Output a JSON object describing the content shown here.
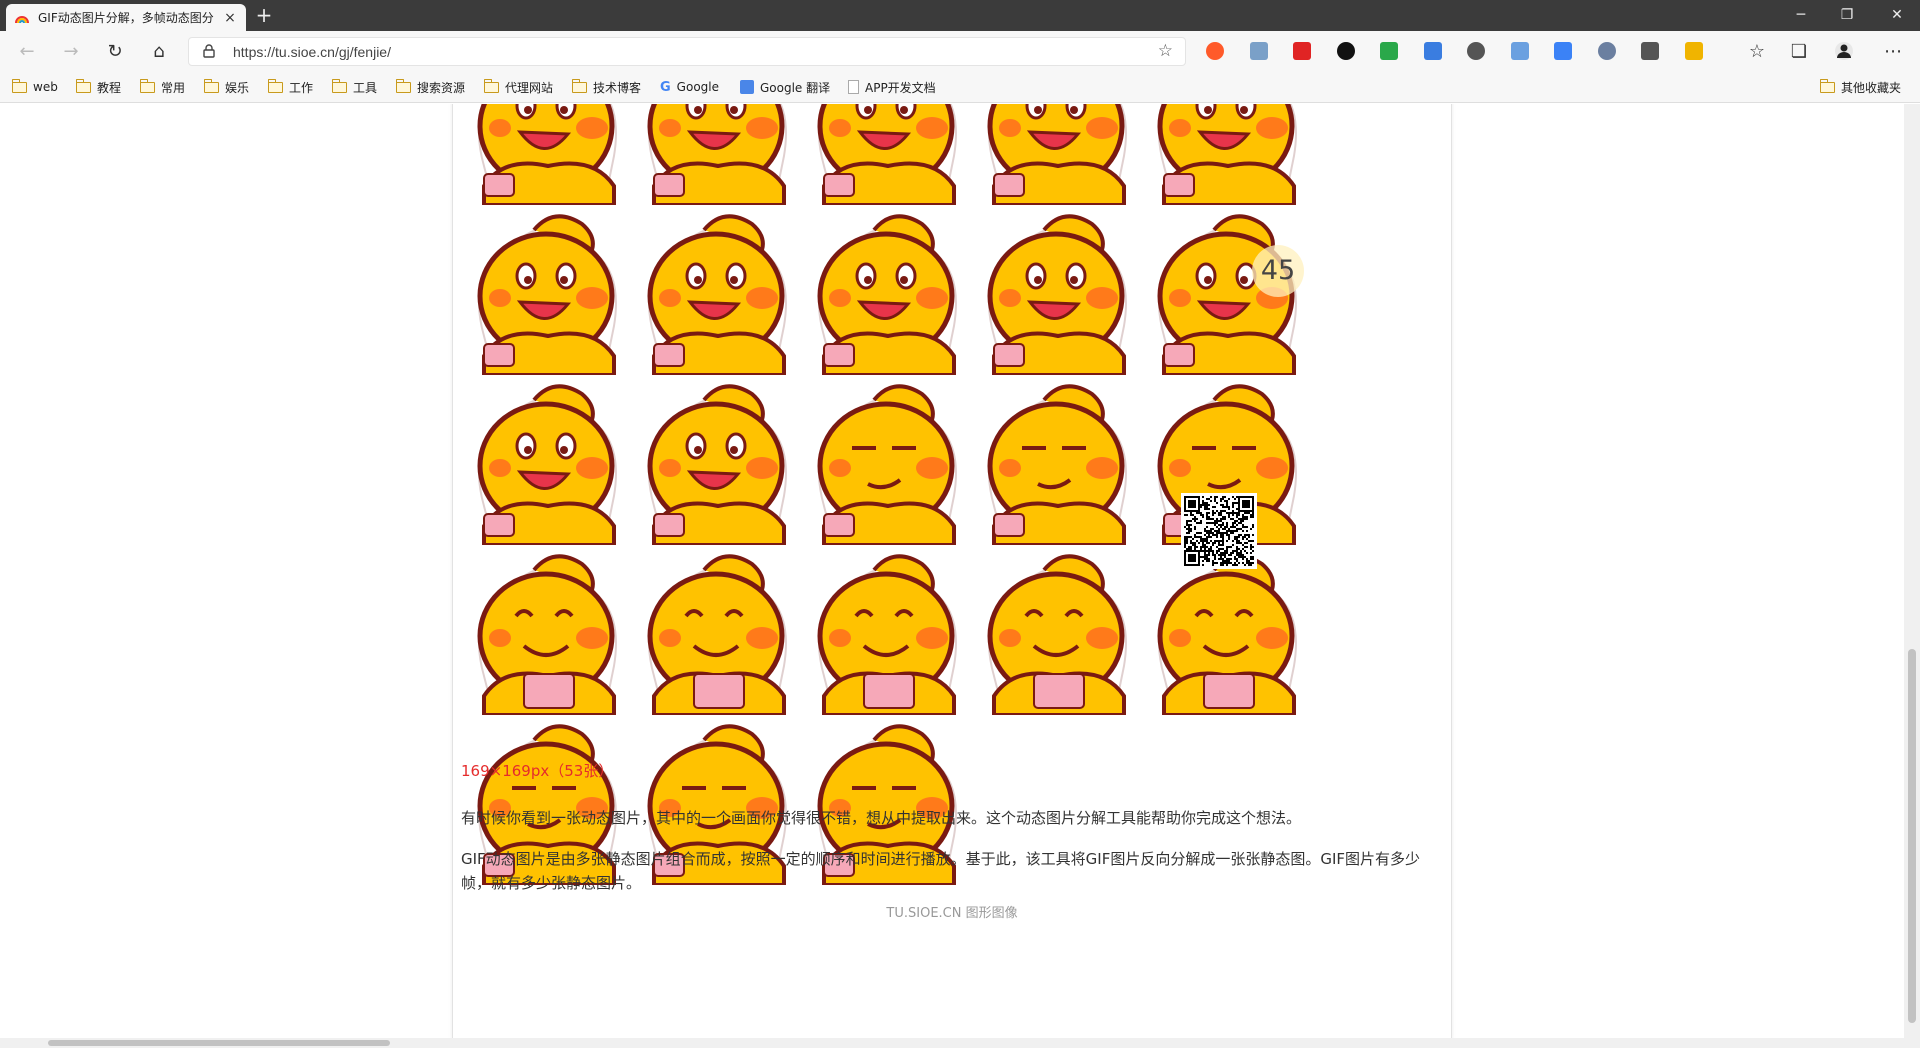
{
  "browser": {
    "tab": {
      "title": "GIF动态图片分解，多帧动态图分",
      "close_glyph": "×",
      "favicon": "rainbow-favicon"
    },
    "new_tab_glyph": "+",
    "window_controls": {
      "minimize": "─",
      "restore": "❐",
      "close": "✕"
    },
    "nav": {
      "back": "←",
      "forward": "→",
      "reload": "↻",
      "home": "⌂"
    },
    "address_bar": {
      "url": "https://tu.sioe.cn/gj/fenjie/",
      "star": "☆"
    },
    "extensions": [
      {
        "name": "ext-infinity-icon",
        "color": "#ff5a2a"
      },
      {
        "name": "ext-owl-icon",
        "color": "#7aa0c8"
      },
      {
        "name": "ext-adblock-icon",
        "color": "#e02424"
      },
      {
        "name": "ext-h-icon",
        "color": "#111111"
      },
      {
        "name": "ext-paw-icon",
        "color": "#2aa84a"
      },
      {
        "name": "ext-globe-icon",
        "color": "#3a7de0"
      },
      {
        "name": "ext-gitzip-icon",
        "color": "#555555"
      },
      {
        "name": "ext-translate-icon",
        "color": "#6aa0e0"
      },
      {
        "name": "ext-jh-icon",
        "color": "#3b82f6"
      },
      {
        "name": "ext-cursor-icon",
        "color": "#6b7fa0"
      },
      {
        "name": "ext-chat-icon",
        "color": "#555555"
      },
      {
        "name": "ext-pinwheel-icon",
        "color": "#f0b400"
      }
    ],
    "toolbar_right": {
      "favorites": "☆",
      "collections": "❏",
      "profile": "profile-avatar",
      "menu": "⋯"
    },
    "bookmarks": [
      {
        "label": "web",
        "type": "folder"
      },
      {
        "label": "教程",
        "type": "folder"
      },
      {
        "label": "常用",
        "type": "folder"
      },
      {
        "label": "娱乐",
        "type": "folder"
      },
      {
        "label": "工作",
        "type": "folder"
      },
      {
        "label": "工具",
        "type": "folder"
      },
      {
        "label": "搜索资源",
        "type": "folder"
      },
      {
        "label": "代理网站",
        "type": "folder"
      },
      {
        "label": "技术博客",
        "type": "folder"
      },
      {
        "label": "Google",
        "type": "google"
      },
      {
        "label": "Google 翻译",
        "type": "translate"
      },
      {
        "label": "APP开发文档",
        "type": "page"
      }
    ],
    "other_bookmarks": "其他收藏夹"
  },
  "page": {
    "frames": {
      "frame_size": "169×169",
      "frame_count": 23,
      "visible_rows": 5,
      "columns": 5,
      "badge_text": "45"
    },
    "result_dims": "169×169px（53张）",
    "description_1": "有时候你看到一张动态图片，其中的一个画面你觉得很不错，想从中提取出来。这个动态图片分解工具能帮助你完成这个想法。",
    "description_2": "GIF动态图片是由多张静态图片组合而成，按照一定的顺序和时间进行播放。基于此，该工具将GIF图片反向分解成一张张静态图。GIF图片有多少帧，就有多少张静态图片。",
    "footer": "TU.SIOE.CN 图形图像"
  },
  "colors": {
    "accent_red": "#e52c2c",
    "character_yellow": "#ffc200",
    "outline": "#7a1a12",
    "cheek": "#ff7a1a",
    "money_pink": "#f6a8b8"
  }
}
